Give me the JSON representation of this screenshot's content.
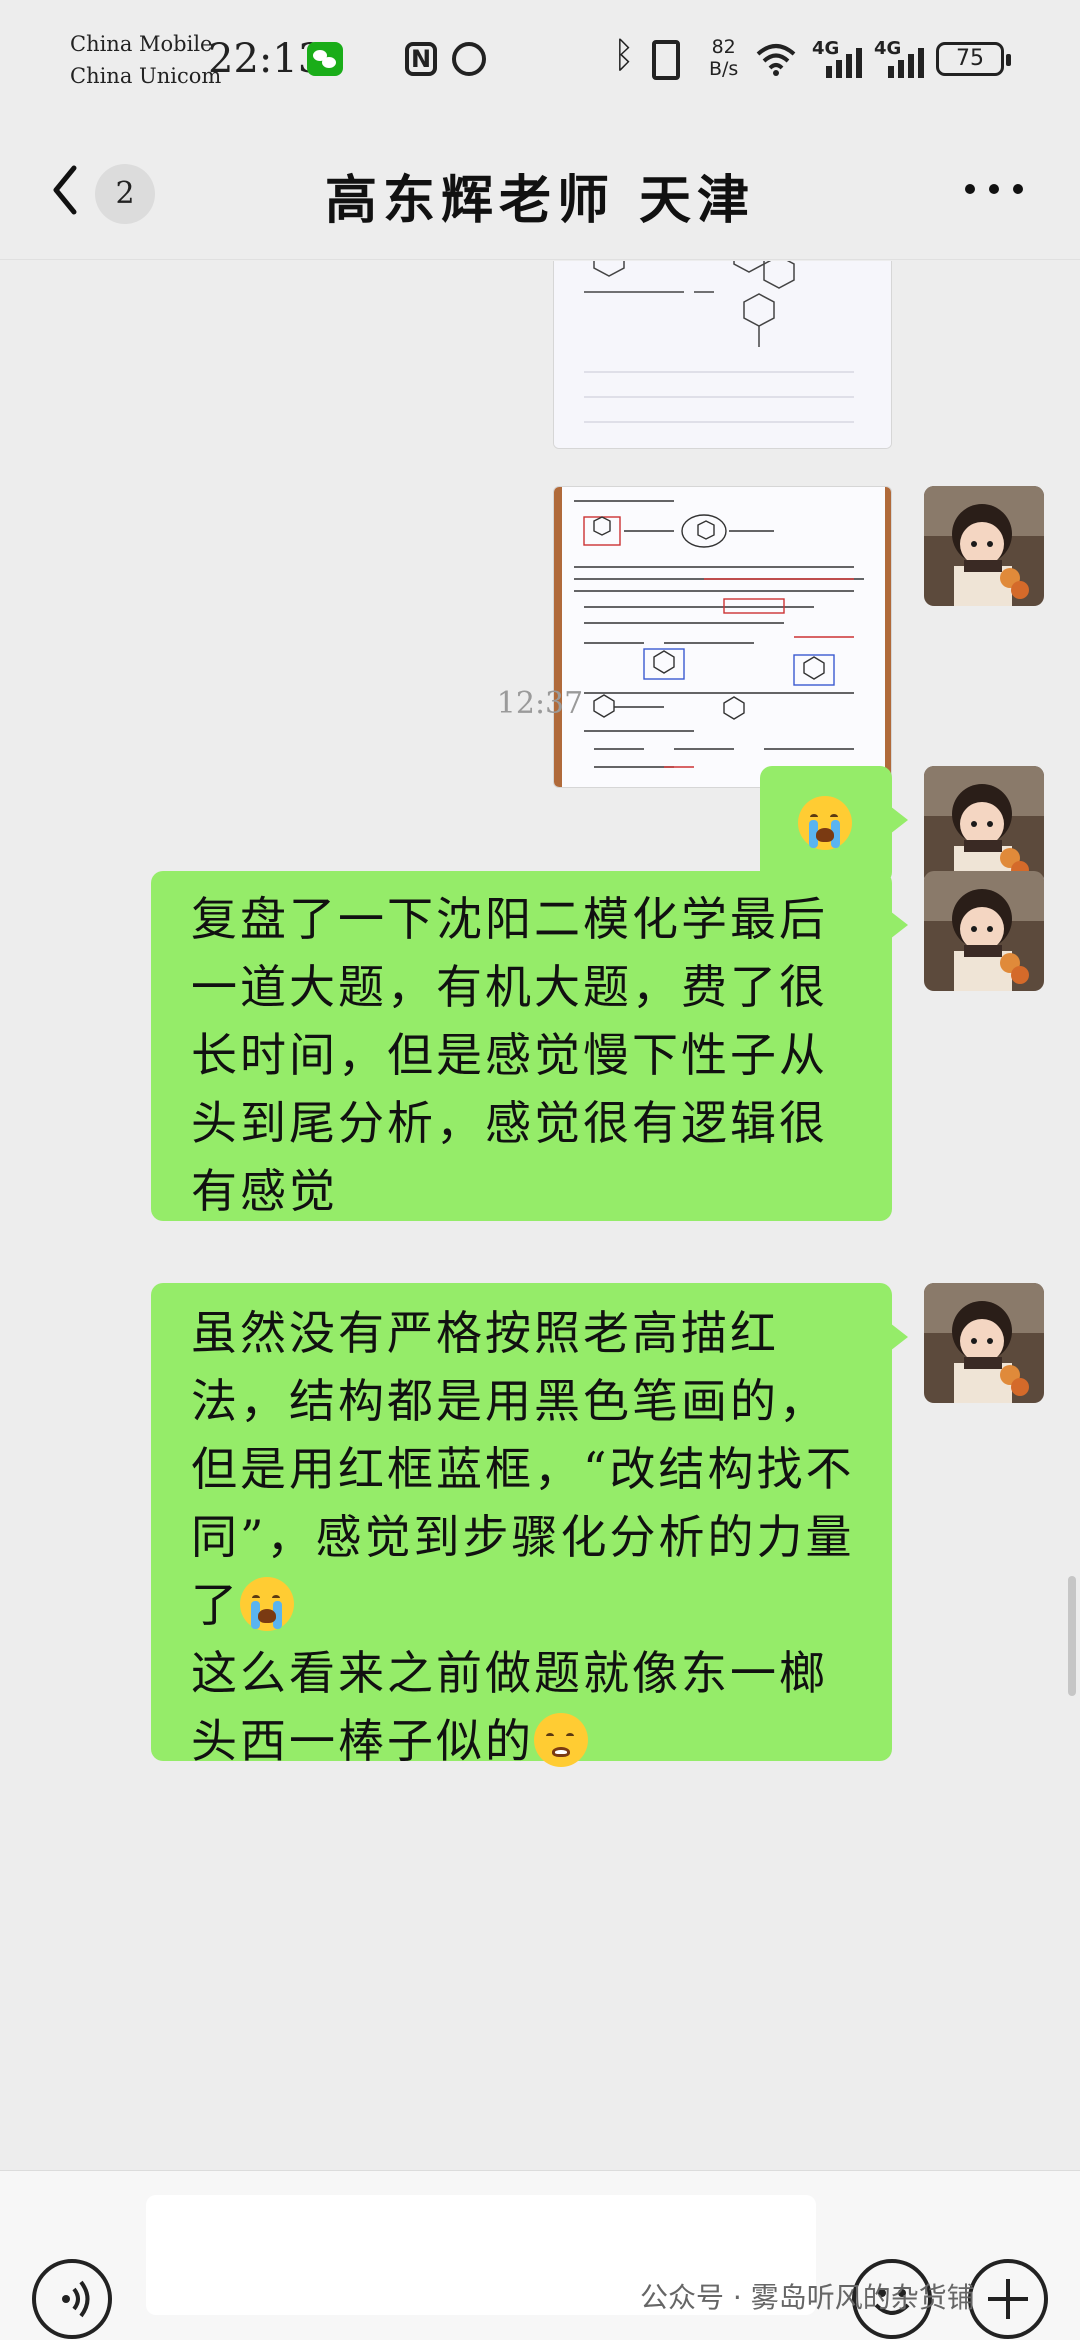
{
  "status_bar": {
    "carrier_1": "China Mobile",
    "carrier_2": "China Unicom",
    "time": "22:13",
    "net_speed_value": "82",
    "net_speed_unit": "B/s",
    "sim1_tag": "4G",
    "sim2_tag": "4G",
    "battery": "75"
  },
  "nav": {
    "unread_count": "2",
    "title": "高东辉老师 天津"
  },
  "chat": {
    "timestamp": "12:37",
    "message_1": "复盘了一下沈阳二模化学最后一道大题，有机大题，费了很长时间，但是感觉慢下性子从头到尾分析，感觉很有逻辑很有感觉",
    "message_2": "虽然没有严格按照老高描红法，结构都是用黑色笔画的，但是用红框蓝框，“改结构找不同”，感觉到步骤化分析的力量了",
    "message_2_tail": "这么看来之前做题就像东一榔头西一棒子似的"
  },
  "input_bar": {
    "text_value": ""
  },
  "watermark": "公众号 · 雾岛听风的杂货铺",
  "colors": {
    "bubble_green": "#95ec69",
    "background": "#ededed",
    "wechat_green": "#1aad19"
  },
  "icons": [
    "wechat-notification-icon",
    "nfc-icon",
    "alarm-icon",
    "bluetooth-icon",
    "vibrate-icon",
    "wifi-icon",
    "signal-icon",
    "battery-icon",
    "back-chevron-icon",
    "more-icon",
    "voice-icon",
    "emoji-icon",
    "plus-icon",
    "crying-emoji-icon",
    "sad-emoji-icon"
  ]
}
